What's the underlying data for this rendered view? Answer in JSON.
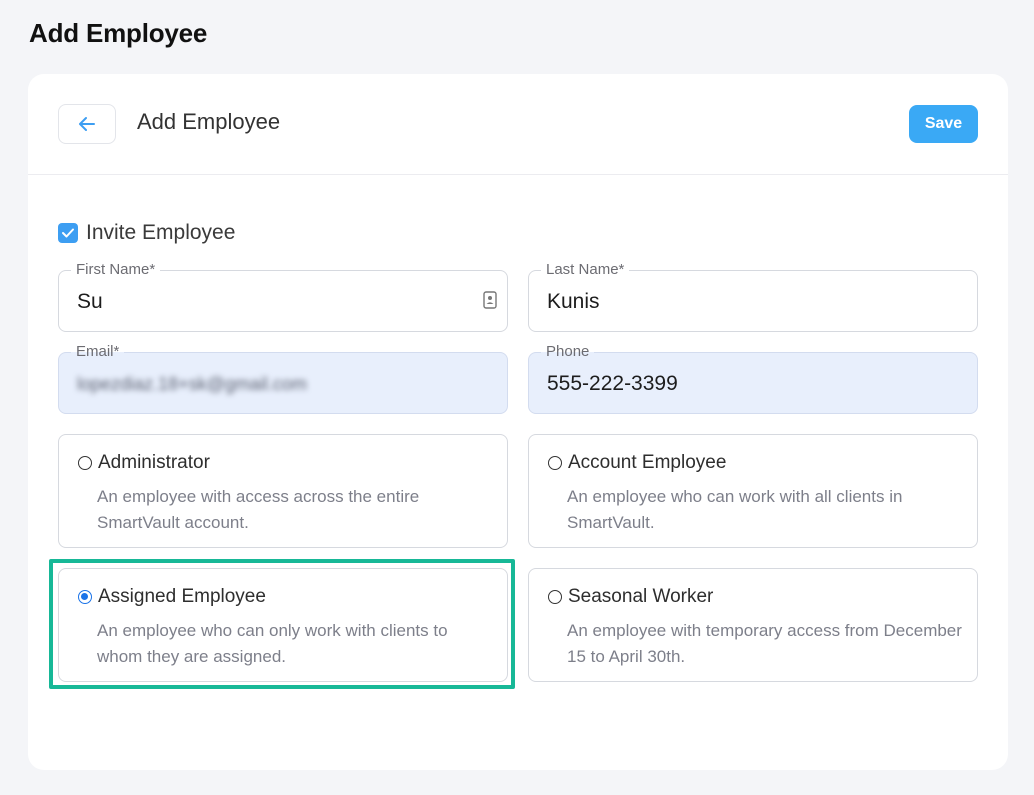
{
  "page": {
    "title": "Add Employee"
  },
  "header": {
    "title": "Add Employee",
    "back_icon": "arrow-left-icon",
    "save_label": "Save"
  },
  "invite": {
    "label": "Invite Employee",
    "checked": true
  },
  "fields": {
    "first_name": {
      "label": "First Name*",
      "value": "Su"
    },
    "last_name": {
      "label": "Last Name*",
      "value": "Kunis"
    },
    "email": {
      "label": "Email*",
      "value": "lopezdiaz.18+sk@gmail.com"
    },
    "phone": {
      "label": "Phone",
      "value": "555-222-3399"
    }
  },
  "roles": [
    {
      "title": "Administrator",
      "description": "An employee with access across the entire SmartVault account.",
      "selected": false
    },
    {
      "title": "Account Employee",
      "description": "An employee who can work with all clients in SmartVault.",
      "selected": false
    },
    {
      "title": "Assigned Employee",
      "description": "An employee who can only work with clients to whom they are assigned.",
      "selected": true
    },
    {
      "title": "Seasonal Worker",
      "description": "An employee with temporary access from December 15 to April 30th.",
      "selected": false
    }
  ],
  "colors": {
    "accent": "#3aa9f5",
    "highlight": "#17b897",
    "radio_selected": "#1a73e8",
    "autofill_bg": "#e8effc"
  }
}
